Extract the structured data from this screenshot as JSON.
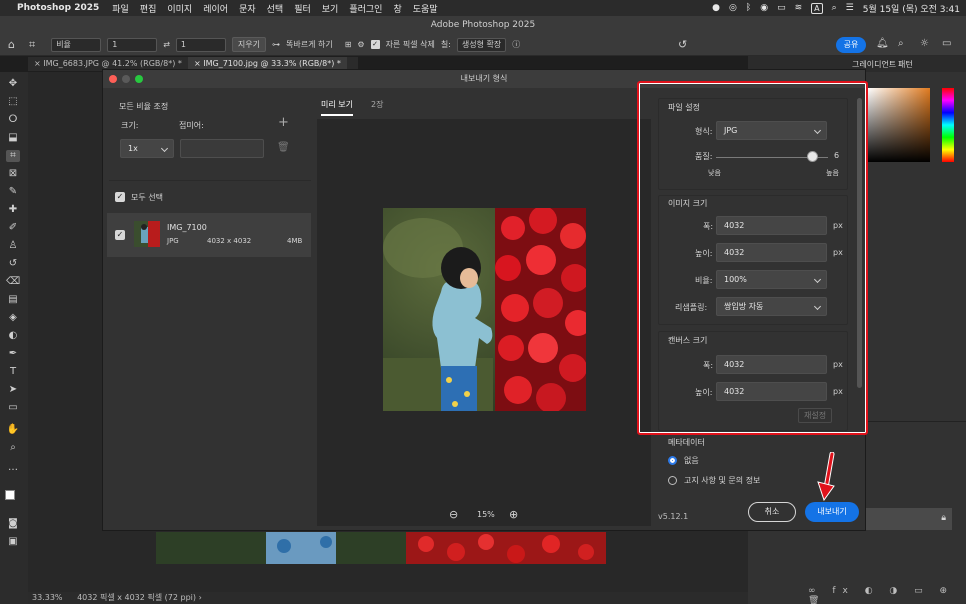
{
  "menubar": {
    "app": "Photoshop 2025",
    "items": [
      "파일",
      "편집",
      "이미지",
      "레이어",
      "문자",
      "선택",
      "필터",
      "보기",
      "플러그인",
      "창",
      "도움말"
    ],
    "input_indicator": "A",
    "datetime": "5월 15일 (목) 오전 3:41"
  },
  "window_title": "Adobe Photoshop 2025",
  "options_bar": {
    "ratio_label": "비율",
    "value1": "1",
    "value2": "1",
    "clear_label": "지우기",
    "straighten_label": "똑바르게 하기",
    "delete_cropped_label": "자른 픽셀 삭제",
    "fill_label": "칠:",
    "fill_value": "생성형 확장",
    "share_label": "공유"
  },
  "doc_tabs": [
    "IMG_6683.JPG @ 41.2% (RGB/8*) *",
    "IMG_7100.jpg @ 33.3% (RGB/8*) *"
  ],
  "status_bar": {
    "zoom": "33.33%",
    "info": "4032 픽셀 x 4032 픽셀 (72 ppi)"
  },
  "right_panel_tabs": [
    "그레이디언트",
    "패턴"
  ],
  "dialog": {
    "title": "내보내기 형식",
    "scale_all": "모든 비율 조정",
    "size_label": "크기:",
    "suffix_label": "접미어:",
    "scale_value": "1x",
    "select_all": "모두 선택",
    "asset": {
      "name": "IMG_7100",
      "format": "JPG",
      "dimensions": "4032 x 4032",
      "filesize": "4MB"
    },
    "preview_tab": "미리 보기",
    "second_tab": "2장",
    "zoom": "15%",
    "file_settings": {
      "title": "파일 설정",
      "format_label": "형식:",
      "format_value": "JPG",
      "quality_label": "품질:",
      "quality_value": "6",
      "quality_max": 7,
      "low_label": "낮음",
      "high_label": "높음"
    },
    "image_size": {
      "title": "이미지 크기",
      "width_label": "폭:",
      "width": "4032",
      "height_label": "높이:",
      "height": "4032",
      "unit": "px",
      "scale_label": "비율:",
      "scale": "100%",
      "resample_label": "리샘플링:",
      "resample": "쌍입방 자동"
    },
    "canvas_size": {
      "title": "캔버스 크기",
      "width_label": "폭:",
      "width": "4032",
      "height_label": "높이:",
      "height": "4032",
      "unit": "px",
      "reset_label": "재설정"
    },
    "metadata": {
      "title": "메타데이터",
      "option_none": "없음",
      "option_copyright": "고지 사항 및 문의 정보"
    },
    "version": "v5.12.1",
    "cancel_label": "취소",
    "export_label": "내보내기"
  },
  "colors": {
    "accent": "#1473e6",
    "highlight_border": "#e0121b",
    "arrow": "#e0121b"
  }
}
